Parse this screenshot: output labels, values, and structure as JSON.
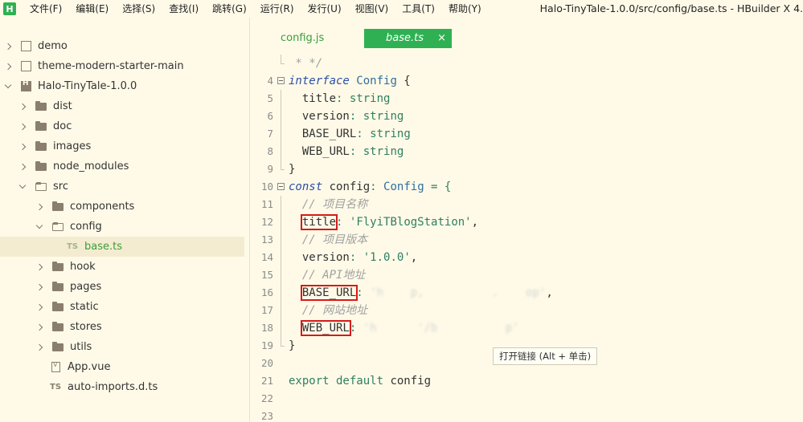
{
  "menubar": {
    "logo": "H",
    "items": [
      "文件(F)",
      "编辑(E)",
      "选择(S)",
      "查找(I)",
      "跳转(G)",
      "运行(R)",
      "发行(U)",
      "视图(V)",
      "工具(T)",
      "帮助(Y)"
    ],
    "window_title": "Halo-TinyTale-1.0.0/src/config/base.ts - HBuilder X 4."
  },
  "sidebar": {
    "tree": [
      {
        "label": "demo"
      },
      {
        "label": "theme-modern-starter-main"
      },
      {
        "label": "Halo-TinyTale-1.0.0"
      },
      {
        "label": "dist"
      },
      {
        "label": "doc"
      },
      {
        "label": "images"
      },
      {
        "label": "node_modules"
      },
      {
        "label": "src"
      },
      {
        "label": "components"
      },
      {
        "label": "config"
      },
      {
        "label": "base.ts",
        "badge": "TS"
      },
      {
        "label": "hook"
      },
      {
        "label": "pages"
      },
      {
        "label": "static"
      },
      {
        "label": "stores"
      },
      {
        "label": "utils"
      },
      {
        "label": "App.vue"
      },
      {
        "label": "auto-imports.d.ts",
        "badge": "TS"
      }
    ]
  },
  "editor": {
    "tabs": [
      {
        "label": "config.js"
      },
      {
        "label": "base.ts",
        "close": "×"
      }
    ],
    "lines": {
      "n4": "4",
      "n5": "5",
      "n6": "6",
      "n7": "7",
      "n8": "8",
      "n9": "9",
      "n10": "10",
      "n11": "11",
      "n12": "12",
      "n13": "13",
      "n14": "14",
      "n15": "15",
      "n16": "16",
      "n17": "17",
      "n18": "18",
      "n19": "19",
      "n20": "20",
      "n21": "21",
      "n22": "22",
      "n23": "23"
    },
    "code": {
      "l4": " * */",
      "interface_kw": "interface",
      "config_type": "Config",
      "brace_open": " {",
      "title_prop": "title",
      "version_prop": "version",
      "base_url_prop": "BASE_URL",
      "web_url_prop": "WEB_URL",
      "colon": ":",
      "string_type": "string",
      "brace_close": "}",
      "const_kw": "const",
      "config_var": " config",
      "eq_open": " = {",
      "cm_name": "// 项目名称",
      "title_val": "'FlyiTBlogStation'",
      "cm_version": "// 项目版本",
      "version_val": "'1.0.0'",
      "comma": ",",
      "cm_api": "// API地址",
      "base_url_val": "'h    p,          .    op'",
      "cm_site": "// 网站地址",
      "web_url_val": "'h      '/b          p'",
      "export_kw": "export default",
      "export_name": " config"
    },
    "tooltip": "打开链接 (Alt + 单击)"
  },
  "colors": {
    "accent_green": "#2fb153",
    "background": "#fffae8",
    "highlight_box": "#d51a1a"
  },
  "icons": {
    "bottom_toolbar": [
      "files-icon",
      "binoculars-icon",
      "bug-icon",
      "plugin-icon",
      "chat-icon"
    ]
  }
}
